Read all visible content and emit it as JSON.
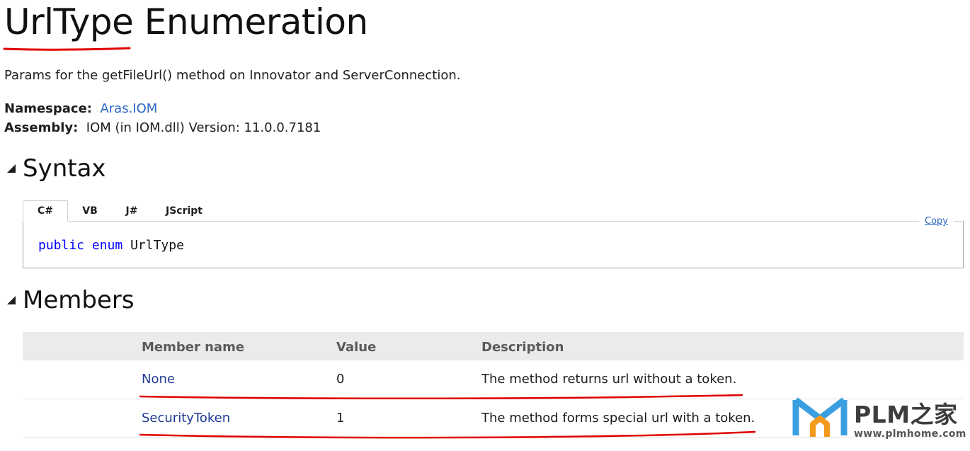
{
  "page": {
    "title": "UrlType Enumeration",
    "summary": "Params for the getFileUrl() method on Innovator and ServerConnection."
  },
  "meta": {
    "namespace_label": "Namespace:",
    "namespace_value": "Aras.IOM",
    "assembly_label": "Assembly:",
    "assembly_value": "IOM (in IOM.dll) Version: 11.0.0.7181"
  },
  "syntax": {
    "heading": "Syntax",
    "tabs": [
      {
        "label": "C#",
        "active": true
      },
      {
        "label": "VB",
        "active": false
      },
      {
        "label": "J#",
        "active": false
      },
      {
        "label": "JScript",
        "active": false
      }
    ],
    "copy_label": "Copy",
    "code": {
      "kw1": "public",
      "kw2": "enum",
      "name": "UrlType"
    }
  },
  "members": {
    "heading": "Members",
    "columns": [
      "Member name",
      "Value",
      "Description"
    ],
    "rows": [
      {
        "name": "None",
        "value": "0",
        "description": "The method returns url without a token."
      },
      {
        "name": "SecurityToken",
        "value": "1",
        "description": "The method forms special url with a token."
      }
    ]
  },
  "watermark": {
    "brand": "PLM之家",
    "url": "www.plmhome.com"
  },
  "colors": {
    "link": "#2a66c4",
    "member_link": "#1f3a93",
    "keyword": "#0000ff",
    "annotation": "#e00000",
    "header_bg": "#ebebeb"
  }
}
